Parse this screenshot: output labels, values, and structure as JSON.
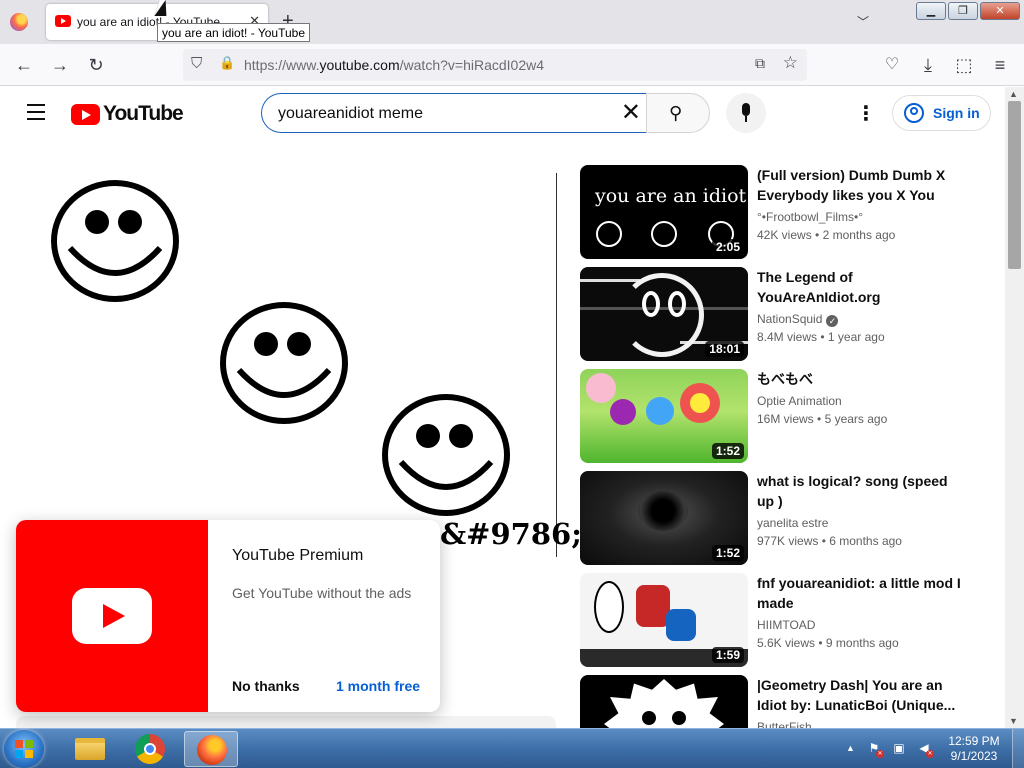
{
  "browser": {
    "tab_title": "you are an idiot! - YouTube",
    "tooltip": "you are an idiot! - YouTube",
    "url_scheme": "https://www.",
    "url_host": "youtube.com",
    "url_path": "/watch?v=hiRacdI02w4",
    "new_tab_symbol": "+",
    "close_symbol": "✕",
    "window_buttons": {
      "minimize": "▁",
      "maximize": "❐",
      "close": "✕"
    }
  },
  "youtube": {
    "logo_text": "YouTube",
    "search_value": "youareanidiot meme",
    "sign_in_label": "Sign in",
    "accent_color": "#065fd4",
    "brand_color": "#ff0000"
  },
  "player": {
    "overlay_text": "&#9786;"
  },
  "premium_popup": {
    "title": "YouTube Premium",
    "subtitle": "Get YouTube without the ads",
    "no_thanks_label": "No thanks",
    "free_trial_label": "1 month free"
  },
  "recommendations": [
    {
      "title": "(Full version) Dumb Dumb X Everybody likes you X You are...",
      "channel": "°•Frootbowl_Films•°",
      "views": "42K views",
      "age": "2 months ago",
      "duration": "2:05",
      "thumb_text": "you are an idiot",
      "verified": false
    },
    {
      "title": "The Legend of YouAreAnIdiot.org",
      "channel": "NationSquid",
      "views": "8.4M views",
      "age": "1 year ago",
      "duration": "18:01",
      "verified": true
    },
    {
      "title": "もべもべ",
      "channel": "Optie Animation",
      "views": "16M views",
      "age": "5 years ago",
      "duration": "1:52",
      "verified": false
    },
    {
      "title": "what is logical? song (speed up )",
      "channel": "yanelita estre",
      "views": "977K views",
      "age": "6 months ago",
      "duration": "1:52",
      "verified": false
    },
    {
      "title": "fnf youareanidiot: a little mod I made",
      "channel": "HIIMTOAD",
      "views": "5.6K views",
      "age": "9 months ago",
      "duration": "1:59",
      "verified": false
    },
    {
      "title": "|Geometry Dash| You are an Idiot by: LunaticBoi (Unique...",
      "channel": "ButterFish",
      "views": "",
      "age": "",
      "duration": "",
      "verified": false
    }
  ],
  "taskbar": {
    "time": "12:59 PM",
    "date": "9/1/2023"
  }
}
